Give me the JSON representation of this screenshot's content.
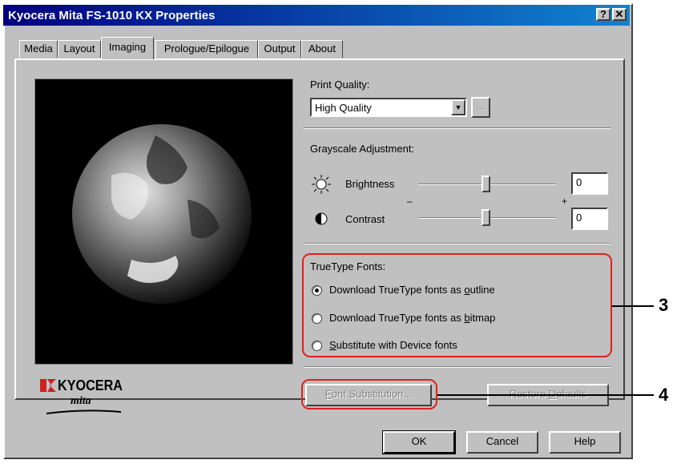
{
  "window": {
    "title": "Kyocera Mita FS-1010 KX Properties",
    "help_label": "?",
    "close_label": "✕"
  },
  "tabs": [
    {
      "label": "Media"
    },
    {
      "label": "Layout"
    },
    {
      "label": "Imaging",
      "active": true
    },
    {
      "label": "Prologue/Epilogue"
    },
    {
      "label": "Output"
    },
    {
      "label": "About"
    }
  ],
  "print_quality": {
    "label": "Print Quality:",
    "value": "High Quality",
    "more_label": "..."
  },
  "grayscale": {
    "label": "Grayscale Adjustment:",
    "brightness": {
      "label": "Brightness",
      "value": "0"
    },
    "contrast": {
      "label": "Contrast",
      "value": "0"
    },
    "minus_label": "–",
    "plus_label": "+"
  },
  "truetype": {
    "label": "TrueType Fonts:",
    "options": [
      {
        "pre": "Download TrueType fonts as ",
        "ul": "o",
        "post": "utline",
        "selected": true
      },
      {
        "pre": "Download TrueType fonts as ",
        "ul": "b",
        "post": "itmap",
        "selected": false
      },
      {
        "pre": "",
        "ul": "S",
        "post": "ubstitute with Device fonts",
        "selected": false
      }
    ]
  },
  "buttons": {
    "font_substitution": {
      "ul": "F",
      "rest": "ont Substitution..."
    },
    "restore_defaults": {
      "pre": "Restore ",
      "ul": "D",
      "post": "efaults"
    },
    "ok": "OK",
    "cancel": "Cancel",
    "help": "Help"
  },
  "logo": {
    "brand": "KYOCERA",
    "sub": "mita"
  },
  "callouts": {
    "c3": "3",
    "c4": "4"
  },
  "colors": {
    "titlebar": "#000080",
    "highlight": "#e02020",
    "face": "#c0c0c0"
  }
}
